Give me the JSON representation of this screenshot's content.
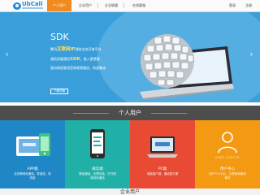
{
  "brand": {
    "name": "UbCall",
    "color": "#1f8ad8"
  },
  "nav": {
    "items": [
      {
        "label": "个人用户",
        "active": true
      },
      {
        "label": "企业用户",
        "active": false
      },
      {
        "label": "企业联盟",
        "active": false
      },
      {
        "label": "在线客服",
        "active": false
      }
    ],
    "login": "登录",
    "register": "注册",
    "accent": "#f08a1c"
  },
  "hero": {
    "title": "SDK",
    "line1_pre": "腾讯",
    "line1_highlight": "互联网IP",
    "line1_post": "通信业务开放平台",
    "line2_pre": "通话质量通话",
    "line2_highlight": "SDK",
    "line2_post": "，接入更便捷",
    "line3": "面向高质量语音和视频通信，快速集成",
    "button": "了解详情",
    "prev_icon": "chevron-left-icon",
    "next_icon": "chevron-right-icon"
  },
  "personal_section": {
    "title": "个人用户",
    "cards": [
      {
        "title": "APP端",
        "desc1": "支持跨网络通话，零漫游，低",
        "desc2": "资费",
        "color": "#1f87c6",
        "icon": "tablet-phone-icon"
      },
      {
        "title": "微信端",
        "desc1": "微信通话，无需安装，打开便",
        "desc2": "能轻松通话",
        "color": "#21b0a8",
        "icon": "phone-wechat-icon"
      },
      {
        "title": "PC端",
        "desc1": "电脑客户端，通话更方便",
        "desc2": "",
        "color": "#e84a33",
        "icon": "laptop-icon"
      },
      {
        "title": "用户中心",
        "desc1": "用户个人中心，方便查询使用",
        "desc2": "情况",
        "color": "#f39a12",
        "icon": "user-icon",
        "badge": "USER CENTER"
      }
    ]
  },
  "enterprise_section": {
    "title": "企业用户"
  }
}
